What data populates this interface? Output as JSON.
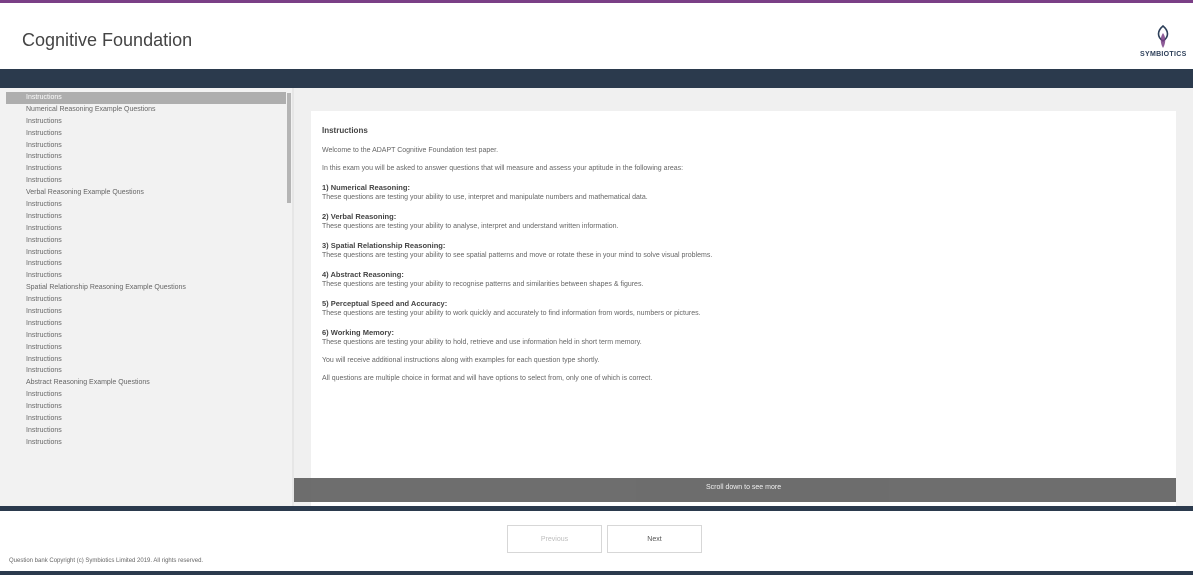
{
  "header": {
    "title": "Cognitive Foundation",
    "logo_text": "SYMBIOTICS",
    "logo_icon": "symbiotics-logo-icon"
  },
  "sidebar": {
    "items": [
      {
        "label": "Instructions",
        "type": "selected"
      },
      {
        "label": "Numerical Reasoning Example Questions",
        "type": "section"
      },
      {
        "label": "Instructions",
        "type": "sub"
      },
      {
        "label": "Instructions",
        "type": "sub"
      },
      {
        "label": "Instructions",
        "type": "sub"
      },
      {
        "label": "Instructions",
        "type": "sub"
      },
      {
        "label": "Instructions",
        "type": "sub"
      },
      {
        "label": "Instructions",
        "type": "sub"
      },
      {
        "label": "Verbal Reasoning Example Questions",
        "type": "section"
      },
      {
        "label": "Instructions",
        "type": "sub"
      },
      {
        "label": "Instructions",
        "type": "sub"
      },
      {
        "label": "Instructions",
        "type": "sub"
      },
      {
        "label": "Instructions",
        "type": "sub"
      },
      {
        "label": "Instructions",
        "type": "sub"
      },
      {
        "label": "Instructions",
        "type": "sub"
      },
      {
        "label": "Instructions",
        "type": "sub"
      },
      {
        "label": "Spatial Relationship Reasoning Example Questions",
        "type": "section"
      },
      {
        "label": "Instructions",
        "type": "sub"
      },
      {
        "label": "Instructions",
        "type": "sub"
      },
      {
        "label": "Instructions",
        "type": "sub"
      },
      {
        "label": "Instructions",
        "type": "sub"
      },
      {
        "label": "Instructions",
        "type": "sub"
      },
      {
        "label": "Instructions",
        "type": "sub"
      },
      {
        "label": "Instructions",
        "type": "sub"
      },
      {
        "label": "Abstract Reasoning Example Questions",
        "type": "section"
      },
      {
        "label": "Instructions",
        "type": "sub"
      },
      {
        "label": "Instructions",
        "type": "sub"
      },
      {
        "label": "Instructions",
        "type": "sub"
      },
      {
        "label": "Instructions",
        "type": "sub"
      },
      {
        "label": "Instructions",
        "type": "sub"
      }
    ]
  },
  "main": {
    "heading": "Instructions",
    "intro": "Welcome to the ADAPT Cognitive Foundation test paper.",
    "description": "In this exam you will be asked to answer questions that will measure and assess your aptitude in the following areas:",
    "sections": [
      {
        "title": "1) Numerical Reasoning:",
        "desc": "These questions are testing your ability to use, interpret and manipulate numbers and mathematical data."
      },
      {
        "title": "2) Verbal Reasoning:",
        "desc": "These questions are testing your ability to analyse, interpret and understand written information."
      },
      {
        "title": "3) Spatial Relationship Reasoning:",
        "desc": "These questions are testing your ability to see spatial patterns and move or rotate these in your mind to solve visual problems."
      },
      {
        "title": "4) Abstract Reasoning:",
        "desc": "These questions are testing your ability to recognise patterns and similarities between shapes & figures."
      },
      {
        "title": "5) Perceptual Speed and Accuracy:",
        "desc": "These questions are testing your ability to work quickly and accurately to find information from words, numbers or pictures."
      },
      {
        "title": "6) Working Memory:",
        "desc": "These questions are testing your ability to hold, retrieve and use information held in short term memory."
      }
    ],
    "additional": "You will receive additional instructions along with examples for each question type shortly.",
    "note": "All questions are multiple choice in format and will have options to select from, only one of which is correct.",
    "scroll_hint": "Scroll down to see more"
  },
  "footer": {
    "previous_label": "Previous",
    "next_label": "Next",
    "copyright": "Question bank Copyright (c) Symbiotics Limited 2019. All rights reserved."
  },
  "colors": {
    "accent_top": "#7a3f86",
    "dark_bar": "#2b3a4d",
    "sidebar_bg": "#f2f2f2",
    "selected_bg": "#aeaeae"
  }
}
